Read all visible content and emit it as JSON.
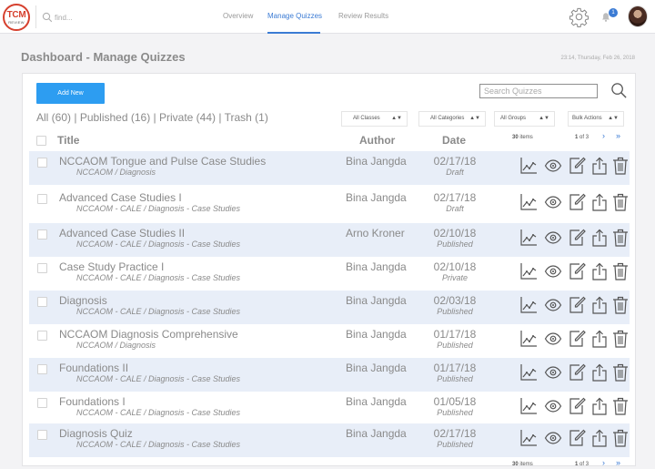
{
  "topbar": {
    "logo_main": "TCM",
    "logo_sub": "REVIEW",
    "find_placeholder": "find...",
    "tabs": [
      {
        "label": "Overview",
        "active": false
      },
      {
        "label": "Manage Quizzes",
        "active": true
      },
      {
        "label": "Review Results",
        "active": false
      }
    ],
    "notification_count": "1"
  },
  "page": {
    "title": "Dashboard - Manage Quizzes",
    "timestamp": "23:14, Thursday, Feb 26, 2018"
  },
  "toolbar": {
    "add_new_label": "Add New",
    "search_placeholder": "Search Quizzes"
  },
  "filters": {
    "all": "All (60)",
    "published": "Published (16)",
    "private": "Private (44)",
    "trash": "Trash (1)",
    "separator": " | ",
    "selects": [
      "All Classes",
      "All Categories",
      "All Groups",
      "Bulk Actions"
    ]
  },
  "table": {
    "headers": {
      "title": "Title",
      "author": "Author",
      "date": "Date"
    },
    "items_count": "30",
    "items_label": "items",
    "page_current": "1",
    "page_of": "of",
    "page_total": "3",
    "next_symbol": "›",
    "last_symbol": "»",
    "rows": [
      {
        "title": "NCCAOM Tongue and Pulse Case Studies",
        "category": "NCCAOM  / Diagnosis",
        "author": "Bina Jangda",
        "date": "02/17/18",
        "status": "Draft"
      },
      {
        "title": "Advanced Case Studies I",
        "category": "NCCAOM - CALE / Diagnosis - Case Studies",
        "author": "Bina Jangda",
        "date": "02/17/18",
        "status": "Draft"
      },
      {
        "title": "Advanced Case Studies II",
        "category": "NCCAOM - CALE / Diagnosis - Case Studies",
        "author": "Arno Kroner",
        "date": "02/10/18",
        "status": "Published"
      },
      {
        "title": "Case Study Practice I",
        "category": "NCCAOM - CALE / Diagnosis - Case Studies",
        "author": "Bina Jangda",
        "date": "02/10/18",
        "status": "Private"
      },
      {
        "title": "Diagnosis",
        "category": "NCCAOM - CALE / Diagnosis - Case Studies",
        "author": "Bina Jangda",
        "date": "02/03/18",
        "status": "Published"
      },
      {
        "title": "NCCAOM Diagnosis Comprehensive",
        "category": "NCCAOM  / Diagnosis",
        "author": "Bina Jangda",
        "date": "01/17/18",
        "status": "Published"
      },
      {
        "title": "Foundations II",
        "category": "NCCAOM - CALE / Diagnosis - Case Studies",
        "author": "Bina Jangda",
        "date": "01/17/18",
        "status": "Published"
      },
      {
        "title": "Foundations I",
        "category": "NCCAOM - CALE / Diagnosis - Case Studies",
        "author": "Bina Jangda",
        "date": "01/05/18",
        "status": "Published"
      },
      {
        "title": "Diagnosis Quiz",
        "category": "NCCAOM - CALE / Diagnosis - Case Studies",
        "author": "Bina Jangda",
        "date": "02/17/18",
        "status": "Published"
      }
    ],
    "row_actions": [
      "stats-icon",
      "view-icon",
      "edit-icon",
      "export-icon",
      "trash-icon"
    ]
  },
  "colors": {
    "accent": "#3b7bd4",
    "button": "#2d9df1",
    "row_stripe": "#e8eef8",
    "logo_red": "#d6402e"
  }
}
